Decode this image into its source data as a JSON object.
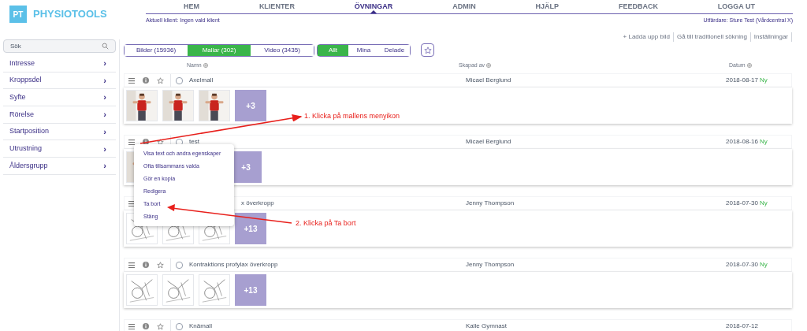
{
  "header": {
    "logo_badge": "PT",
    "logo_text": "PHYSIOTOOLS",
    "current_client": "Aktuell klient: Ingen vald klient",
    "issuer": "Utfärdare: Sture Test (Vårdcentral X)",
    "nav": [
      {
        "label": "HEM",
        "selected": false
      },
      {
        "label": "KLIENTER",
        "selected": false
      },
      {
        "label": "ÖVNINGAR",
        "selected": true
      },
      {
        "label": "ADMIN",
        "selected": false
      },
      {
        "label": "HJÄLP",
        "selected": false
      },
      {
        "label": "FEEDBACK",
        "selected": false
      },
      {
        "label": "LOGGA UT",
        "selected": false
      }
    ]
  },
  "toolbar_links": [
    "+ Ladda upp bild",
    "Gå till traditionell sökning",
    "Inställningar"
  ],
  "sidebar": {
    "search_placeholder": "Sök",
    "items": [
      {
        "label": "Intresse",
        "chevron": "›"
      },
      {
        "label": "Kroppsdel",
        "chevron": "›"
      },
      {
        "label": "Syfte",
        "chevron": "›"
      },
      {
        "label": "Rörelse",
        "chevron": "›"
      },
      {
        "label": "Startposition",
        "chevron": "›"
      },
      {
        "label": "Utrustning",
        "chevron": "›"
      },
      {
        "label": "Åldersgrupp",
        "chevron": "›"
      }
    ]
  },
  "type_tabs": [
    {
      "label": "Bilder (15936)",
      "selected": false
    },
    {
      "label": "Mallar (302)",
      "selected": true
    },
    {
      "label": "Video (3435)",
      "selected": false
    }
  ],
  "owner_tabs": [
    {
      "label": "Allt",
      "selected": true
    },
    {
      "label": "Mina",
      "selected": false
    },
    {
      "label": "Delade",
      "selected": false
    }
  ],
  "columns": [
    "Namn",
    "Skapad av",
    "Datum"
  ],
  "rows": [
    {
      "name": "Axelmall",
      "author": "Micael Berglund",
      "date": "2018-08-17",
      "badge": "Ny",
      "checked": false,
      "more": "+3"
    },
    {
      "name": "test",
      "author": "Micael Berglund",
      "date": "2018-08-16",
      "badge": "Ny",
      "checked": false,
      "more": "+3",
      "menu_open": true
    },
    {
      "name": "x överkropp",
      "author": "Jenny Thompson",
      "date": "2018-07-30",
      "badge": "Ny",
      "more": "+13",
      "thumbnails": [
        {
          "kind": "drawing"
        },
        {
          "kind": "drawing"
        },
        {
          "kind": "drawing"
        }
      ]
    },
    {
      "name": "Kontraktions profylax överkropp",
      "author": "Jenny Thompson",
      "date": "2018-07-30",
      "badge": "Ny",
      "checked": false,
      "more": "+13",
      "thumbnails": [
        {
          "kind": "drawing"
        },
        {
          "kind": "drawing"
        },
        {
          "kind": "drawing"
        }
      ]
    },
    {
      "name": "Knämall",
      "author": "Kalle Gymnast",
      "date": "2018-07-12",
      "checked": false
    }
  ],
  "context_menu": [
    "Visa text och andra egenskaper",
    "Ofta tillsammans valda",
    "Gör en kopia",
    "Redigera",
    "Ta bort",
    "Stäng"
  ],
  "annotations": [
    "1. Klicka på mallens menyikon",
    "2. Klicka på Ta bort"
  ]
}
